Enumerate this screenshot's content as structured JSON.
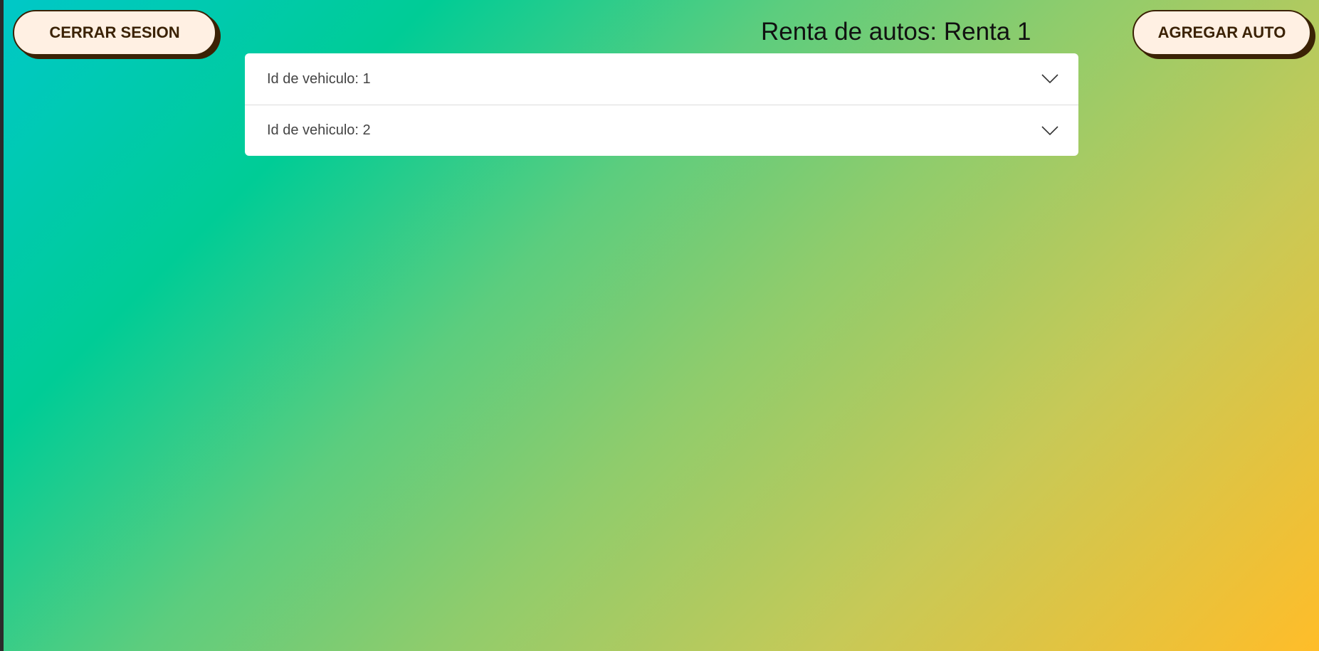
{
  "header": {
    "logout_label": "CERRAR SESION",
    "title": "Renta de autos: Renta 1",
    "add_label": "AGREGAR AUTO"
  },
  "vehicles": [
    {
      "label": "Id de vehiculo: 1",
      "icon": "chevron-down-icon"
    },
    {
      "label": "Id de vehiculo: 2",
      "icon": "chevron-down-icon"
    }
  ],
  "colors": {
    "button_bg": "#fff0e3",
    "button_text": "#3b2205",
    "gradient_start": "#00c8c8",
    "gradient_end": "#ffbd29"
  }
}
